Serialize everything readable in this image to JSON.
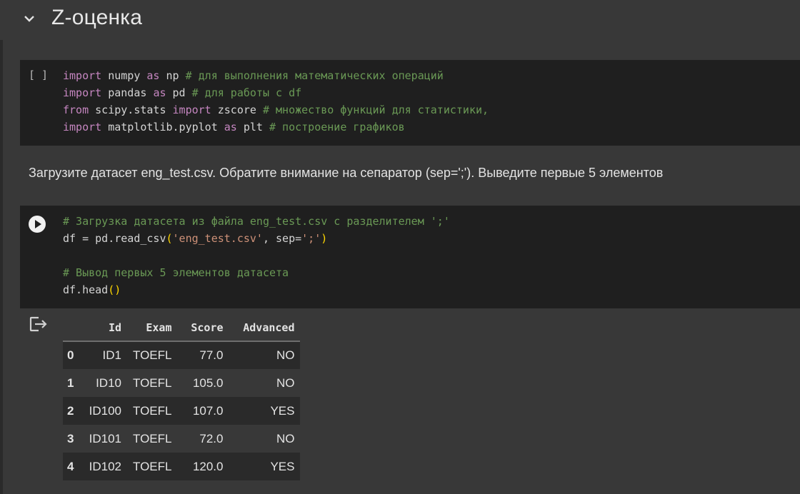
{
  "section": {
    "title": "Z-оценка",
    "icon": "chevron-down-icon"
  },
  "cell1": {
    "exec_count": "[ ]",
    "lines": [
      [
        {
          "t": "import",
          "c": "kw"
        },
        {
          "t": " numpy ",
          "c": ""
        },
        {
          "t": "as",
          "c": "kw"
        },
        {
          "t": " np ",
          "c": ""
        },
        {
          "t": "# для выполнения математических операций",
          "c": "cm"
        }
      ],
      [
        {
          "t": "import",
          "c": "kw"
        },
        {
          "t": " pandas ",
          "c": ""
        },
        {
          "t": "as",
          "c": "kw"
        },
        {
          "t": " pd ",
          "c": ""
        },
        {
          "t": "# для работы с df",
          "c": "cm"
        }
      ],
      [
        {
          "t": "from",
          "c": "kw"
        },
        {
          "t": " scipy.stats ",
          "c": ""
        },
        {
          "t": "import",
          "c": "kw"
        },
        {
          "t": " zscore ",
          "c": ""
        },
        {
          "t": "# множество функций для статистики,",
          "c": "cm"
        }
      ],
      [
        {
          "t": "import",
          "c": "kw"
        },
        {
          "t": " matplotlib.pyplot ",
          "c": ""
        },
        {
          "t": "as",
          "c": "kw"
        },
        {
          "t": " plt ",
          "c": ""
        },
        {
          "t": "# построение графиков",
          "c": "cm"
        }
      ]
    ]
  },
  "markdown": {
    "text": "Загрузите датасет eng_test.csv. Обратите внимание на сепаратор (sep=';'). Выведите первые 5 элементов"
  },
  "cell2": {
    "run_icon": "play-icon",
    "lines": [
      [
        {
          "t": "# Загрузка датасета из файла eng_test.csv с разделителем ';'",
          "c": "cm"
        }
      ],
      [
        {
          "t": "df = pd.read_csv",
          "c": ""
        },
        {
          "t": "(",
          "c": "pn"
        },
        {
          "t": "'eng_test.csv'",
          "c": "st"
        },
        {
          "t": ", sep=",
          "c": ""
        },
        {
          "t": "';'",
          "c": "st"
        },
        {
          "t": ")",
          "c": "pn"
        }
      ],
      [],
      [
        {
          "t": "# Вывод первых 5 элементов датасета",
          "c": "cm"
        }
      ],
      [
        {
          "t": "df.head",
          "c": ""
        },
        {
          "t": "()",
          "c": "pn"
        }
      ]
    ]
  },
  "output": {
    "icon": "output-redirect-icon",
    "table": {
      "columns": [
        "",
        "Id",
        "Exam",
        "Score",
        "Advanced"
      ],
      "rows": [
        [
          "0",
          "ID1",
          "TOEFL",
          "77.0",
          "NO"
        ],
        [
          "1",
          "ID10",
          "TOEFL",
          "105.0",
          "NO"
        ],
        [
          "2",
          "ID100",
          "TOEFL",
          "107.0",
          "YES"
        ],
        [
          "3",
          "ID101",
          "TOEFL",
          "72.0",
          "NO"
        ],
        [
          "4",
          "ID102",
          "TOEFL",
          "120.0",
          "YES"
        ]
      ]
    }
  },
  "colors": {
    "background": "#383838",
    "cell_background": "#1f1f1f",
    "keyword": "#c586c0",
    "comment": "#6a9955",
    "string": "#ce9178",
    "bracket": "#ffd700"
  }
}
